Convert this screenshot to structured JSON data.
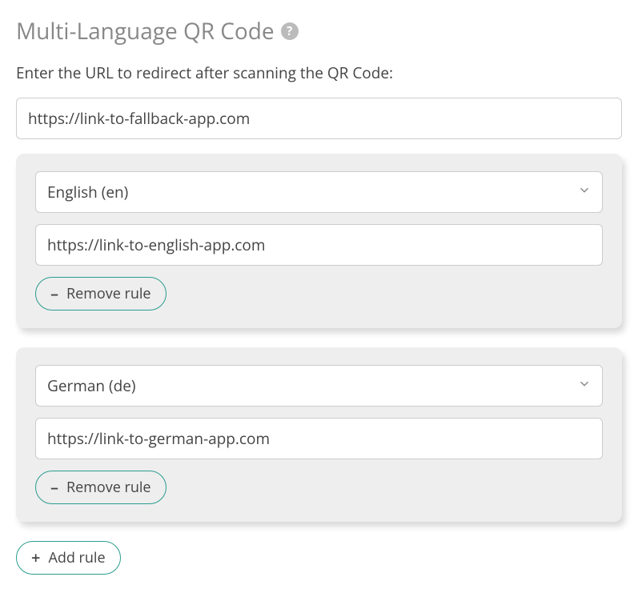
{
  "title": "Multi-Language QR Code",
  "instruction": "Enter the URL to redirect after scanning the QR Code:",
  "fallback_url": "https://link-to-fallback-app.com",
  "rules": [
    {
      "language_label": "English (en)",
      "url": "https://link-to-english-app.com"
    },
    {
      "language_label": "German (de)",
      "url": "https://link-to-german-app.com"
    }
  ],
  "buttons": {
    "remove_rule": "Remove rule",
    "add_rule": "Add rule"
  },
  "icons": {
    "help": "?",
    "minus": "–",
    "plus": "+"
  }
}
